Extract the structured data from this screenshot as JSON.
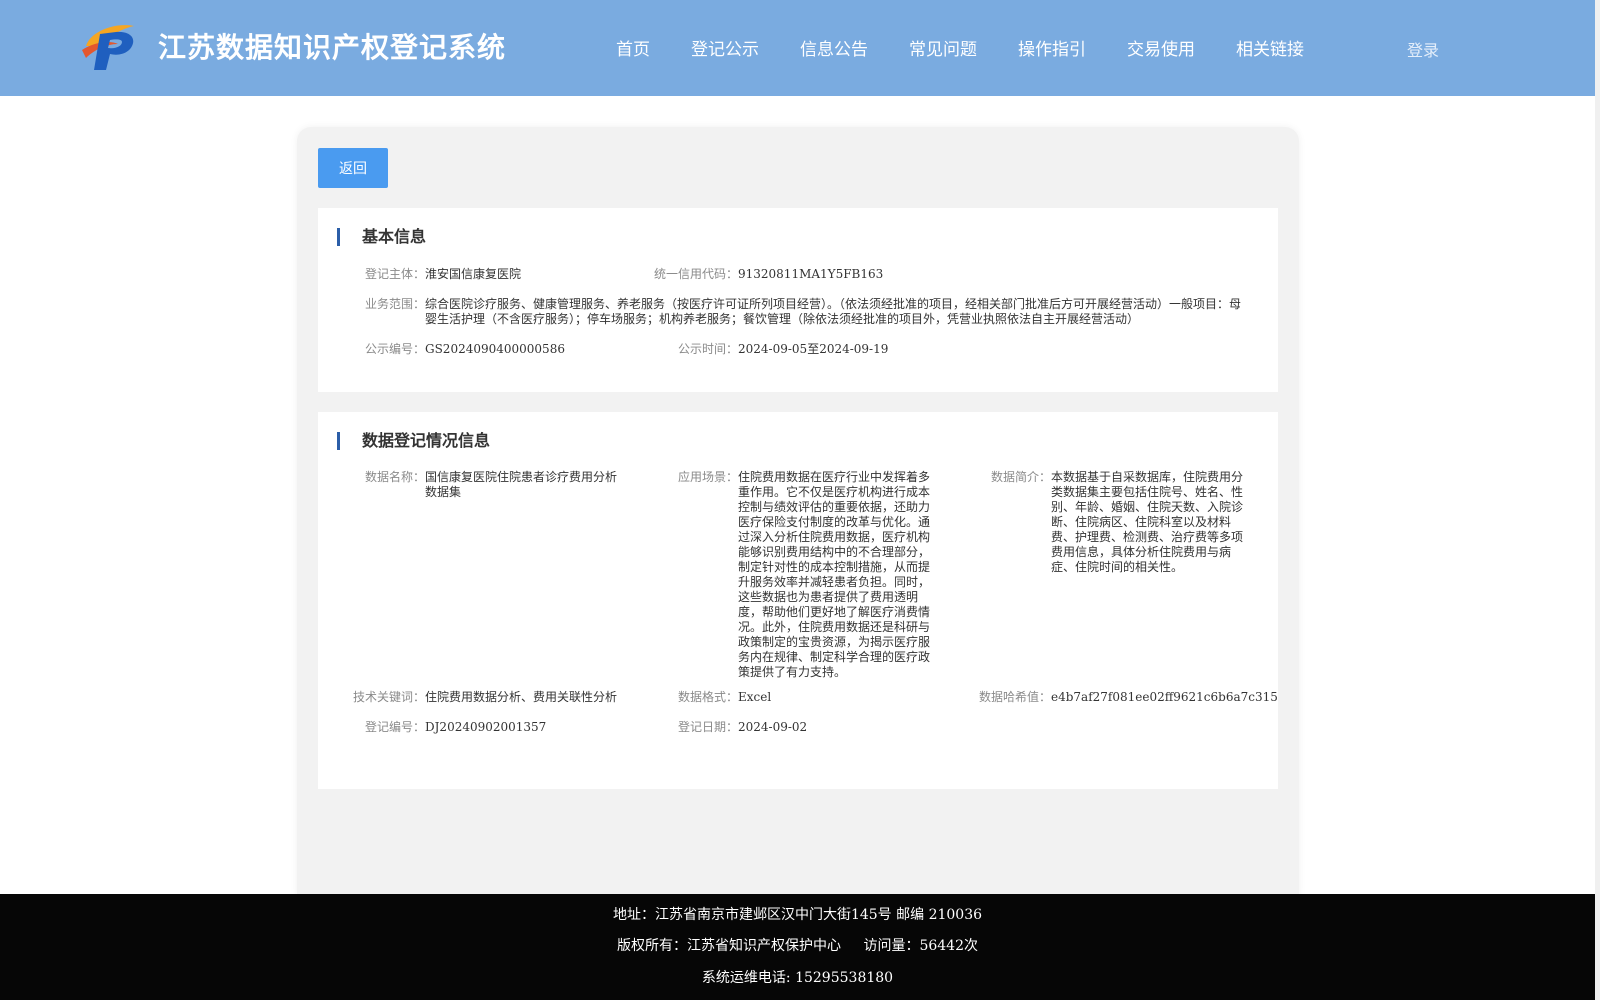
{
  "header": {
    "site_title": "江苏数据知识产权登记系统",
    "logo_icon": "ip-logo-icon",
    "nav": [
      "首页",
      "登记公示",
      "信息公告",
      "常见问题",
      "操作指引",
      "交易使用",
      "相关链接"
    ],
    "login": "登录",
    "background": "#7aabe0"
  },
  "back_button": "返回",
  "basic_info": {
    "title": "基本信息",
    "subject_label": "登记主体：",
    "subject_value": "淮安国信康复医院",
    "credit_label": "统一信用代码：",
    "credit_value": "91320811MA1Y5FB163",
    "scope_label": "业务范围：",
    "scope_value": "综合医院诊疗服务、健康管理服务、养老服务（按医疗许可证所列项目经营）。（依法须经批准的项目，经相关部门批准后方可开展经营活动）一般项目：母婴生活护理（不含医疗服务）；停车场服务；机构养老服务；餐饮管理（除依法须经批准的项目外，凭营业执照依法自主开展经营活动）",
    "notice_no_label": "公示编号：",
    "notice_no_value": "GS2024090400000586",
    "notice_time_label": "公示时间：",
    "notice_time_value": "2024-09-05至2024-09-19"
  },
  "data_info": {
    "title": "数据登记情况信息",
    "name_label": "数据名称：",
    "name_value": "国信康复医院住院患者诊疗费用分析数据集",
    "scene_label": "应用场景：",
    "scene_value": "住院费用数据在医疗行业中发挥着多重作用。它不仅是医疗机构进行成本控制与绩效评估的重要依据，还助力医疗保险支付制度的改革与优化。通过深入分析住院费用数据，医疗机构能够识别费用结构中的不合理部分，制定针对性的成本控制措施，从而提升服务效率并减轻患者负担。同时，这些数据也为患者提供了费用透明度，帮助他们更好地了解医疗消费情况。此外，住院费用数据还是科研与政策制定的宝贵资源，为揭示医疗服务内在规律、制定科学合理的医疗政策提供了有力支持。",
    "intro_label": "数据简介：",
    "intro_value": "本数据基于自采数据库，住院费用分类数据集主要包括住院号、姓名、性别、年龄、婚姻、住院天数、入院诊断、住院病区、住院科室以及材料费、护理费、检测费、治疗费等多项费用信息，具体分析住院费用与病症、住院时间的相关性。",
    "keywords_label": "技术关键词：",
    "keywords_value": "住院费用数据分析、费用关联性分析",
    "format_label": "数据格式：",
    "format_value": "Excel",
    "hash_label": "数据哈希值：",
    "hash_value": "e4b7af27f081ee02ff9621c6b6a7c315",
    "reg_no_label": "登记编号：",
    "reg_no_value": "DJ20240902001357",
    "reg_date_label": "登记日期：",
    "reg_date_value": "2024-09-02"
  },
  "footer": {
    "address": "地址：江苏省南京市建邺区汉中门大街145号 邮编 210036",
    "copyright": "版权所有：江苏省知识产权保护中心",
    "visits": "访问量：56442次",
    "phone": "系统运维电话: 15295538180"
  }
}
